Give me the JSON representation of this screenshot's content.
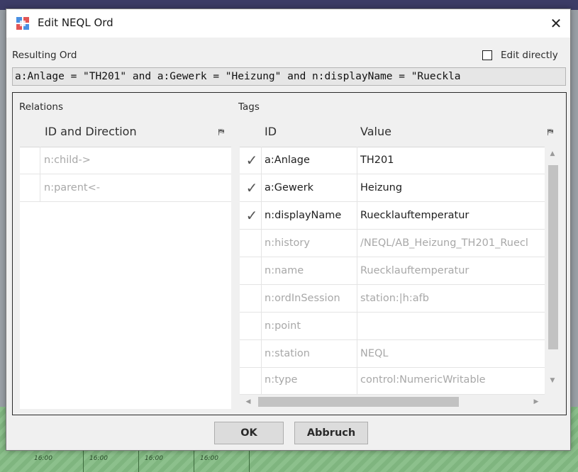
{
  "dialog": {
    "title": "Edit NEQL Ord",
    "close_glyph": "✕",
    "icons": {
      "app": "neql-app-icon",
      "close": "close-icon"
    }
  },
  "resulting_ord": {
    "label": "Resulting Ord",
    "edit_directly_label": "Edit directly",
    "edit_directly_checked": false,
    "value": "a:Anlage = \"TH201\" and a:Gewerk = \"Heizung\" and n:displayName = \"Rueckla"
  },
  "relations": {
    "label": "Relations",
    "header": "ID and Direction",
    "rows": [
      {
        "id": "n:child->"
      },
      {
        "id": "n:parent<-"
      }
    ]
  },
  "tags": {
    "label": "Tags",
    "headers": {
      "id": "ID",
      "value": "Value"
    },
    "rows": [
      {
        "checked": true,
        "id": "a:Anlage",
        "value": "TH201"
      },
      {
        "checked": true,
        "id": "a:Gewerk",
        "value": "Heizung"
      },
      {
        "checked": true,
        "id": "n:displayName",
        "value": "Ruecklauftemperatur"
      },
      {
        "checked": false,
        "id": "n:history",
        "value": "/NEQL/AB_Heizung_TH201_Ruecl"
      },
      {
        "checked": false,
        "id": "n:name",
        "value": "Ruecklauftemperatur"
      },
      {
        "checked": false,
        "id": "n:ordInSession",
        "value": "station:|h:afb"
      },
      {
        "checked": false,
        "id": "n:point",
        "value": ""
      },
      {
        "checked": false,
        "id": "n:station",
        "value": "NEQL"
      },
      {
        "checked": false,
        "id": "n:type",
        "value": "control:NumericWritable"
      }
    ]
  },
  "buttons": {
    "ok": "OK",
    "cancel": "Abbruch"
  },
  "background": {
    "times": [
      "16:00",
      "16:00",
      "16:00",
      "16:00"
    ]
  },
  "glyphs": {
    "check": "✓",
    "table_menu": "⛿",
    "arrow_up": "▲",
    "arrow_down": "▼",
    "arrow_left": "◀",
    "arrow_right": "▶"
  }
}
